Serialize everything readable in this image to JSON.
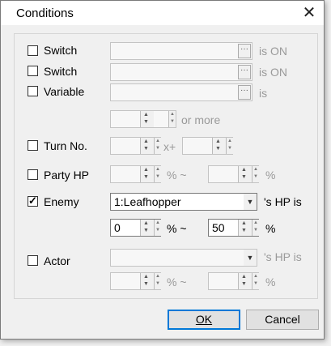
{
  "window": {
    "title": "Conditions",
    "close_glyph": "✕"
  },
  "rows": {
    "switch1": {
      "label": "Switch",
      "suffix": "is ON",
      "dots": "···"
    },
    "switch2": {
      "label": "Switch",
      "suffix": "is ON",
      "dots": "···"
    },
    "variable": {
      "label": "Variable",
      "suffix": "is",
      "dots": "···",
      "or_more": "or more"
    },
    "turn": {
      "label": "Turn No.",
      "plus": "x+"
    },
    "party_hp": {
      "label": "Party HP",
      "pct_tilde": "% ~",
      "pct": "%"
    },
    "enemy": {
      "label": "Enemy",
      "selected": "1:Leafhopper",
      "suffix": "'s HP is",
      "min_value": "0",
      "max_value": "50",
      "pct_tilde": "% ~",
      "pct": "%"
    },
    "actor": {
      "label": "Actor",
      "suffix": "'s HP is",
      "pct_tilde": "% ~",
      "pct": "%"
    }
  },
  "buttons": {
    "ok": "OK",
    "cancel": "Cancel"
  },
  "checked": {
    "enemy": true
  }
}
